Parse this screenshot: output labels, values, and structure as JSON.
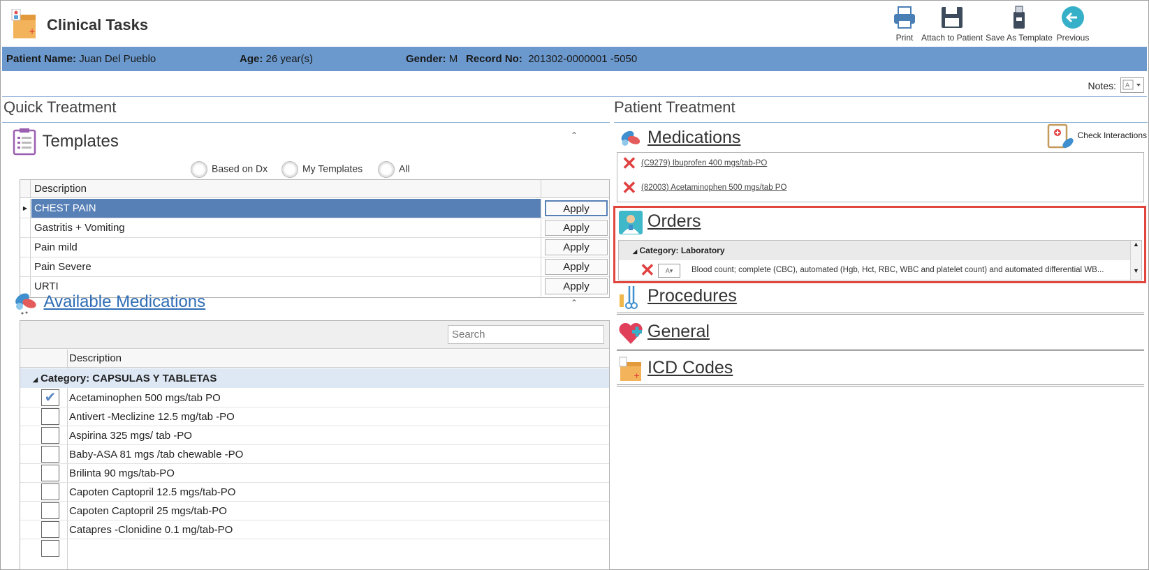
{
  "header": {
    "title": "Clinical Tasks",
    "buttons": [
      {
        "label": "Print"
      },
      {
        "label": "Attach to Patient"
      },
      {
        "label": "Save As Template"
      },
      {
        "label": "Previous"
      }
    ]
  },
  "patient": {
    "name_label": "Patient Name:",
    "name": "Juan Del Pueblo",
    "age_label": "Age:",
    "age": "26 year(s)",
    "gender_label": "Gender:",
    "gender": "M",
    "record_label": "Record No:",
    "record": "201302-0000001 -5050"
  },
  "notes": {
    "label": "Notes:"
  },
  "quick_treatment": {
    "title": "Quick Treatment",
    "templates": {
      "title": "Templates",
      "filters": [
        "Based on Dx",
        "My Templates",
        "All"
      ],
      "column": "Description",
      "apply_label": "Apply",
      "rows": [
        "CHEST PAIN",
        "Gastritis + Vomiting",
        "Pain mild",
        "Pain Severe",
        "URTI"
      ]
    },
    "available_medications": {
      "title": "Available Medications",
      "search_placeholder": "Search",
      "column": "Description",
      "category": "Category: CAPSULAS Y TABLETAS",
      "items": [
        {
          "label": "Acetaminophen 500 mgs/tab PO",
          "checked": true
        },
        {
          "label": "Antivert -Meclizine 12.5 mg/tab -PO",
          "checked": false
        },
        {
          "label": "Aspirina 325 mgs/ tab -PO",
          "checked": false
        },
        {
          "label": "Baby-ASA 81 mgs /tab chewable -PO",
          "checked": false
        },
        {
          "label": "Brilinta 90 mgs/tab-PO",
          "checked": false
        },
        {
          "label": "Capoten Captopril 12.5 mgs/tab-PO",
          "checked": false
        },
        {
          "label": "Capoten Captopril 25 mgs/tab-PO",
          "checked": false
        },
        {
          "label": "Catapres -Clonidine 0.1 mg/tab-PO",
          "checked": false
        }
      ]
    }
  },
  "patient_treatment": {
    "title": "Patient Treatment",
    "medications": {
      "title": "Medications",
      "check_interactions": "Check Interactions",
      "items": [
        "(C9279) Ibuprofen 400 mgs/tab-PO",
        "(82003) Acetaminophen 500 mgs/tab PO"
      ]
    },
    "orders": {
      "title": "Orders",
      "category": "Category: Laboratory",
      "items": [
        "Blood count; complete (CBC), automated (Hgb, Hct, RBC, WBC and platelet count) and automated differential WB..."
      ]
    },
    "procedures": {
      "title": "Procedures"
    },
    "general": {
      "title": "General"
    },
    "icd_codes": {
      "title": "ICD Codes"
    }
  },
  "colors": {
    "header_bar": "#6b99ce",
    "selected_row": "#5780b7",
    "orders_highlight": "#e0463d",
    "link": "#2f6db5"
  }
}
